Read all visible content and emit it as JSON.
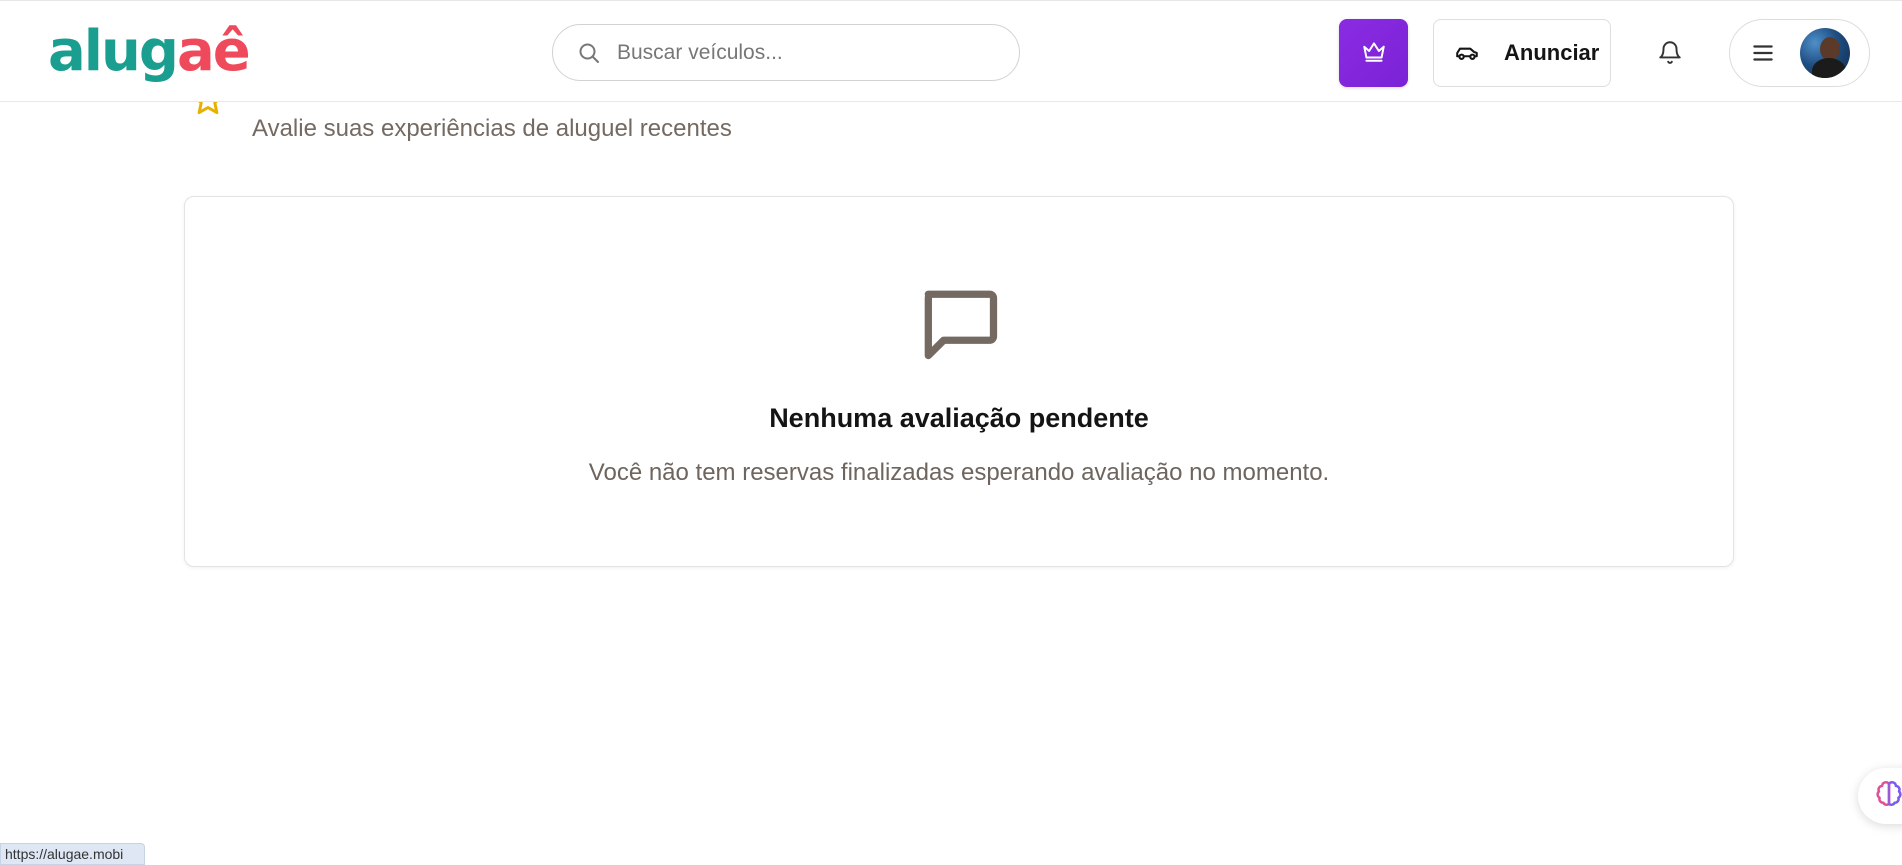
{
  "header": {
    "logo": {
      "part1": "alug",
      "part2": "a",
      "part3": "ê"
    },
    "search": {
      "placeholder": "Buscar veículos..."
    },
    "announce_label": "Anunciar"
  },
  "page": {
    "subtitle": "Avalie suas experiências de aluguel recentes"
  },
  "empty_state": {
    "title": "Nenhuma avaliação pendente",
    "text": "Você não tem reservas finalizadas esperando avaliação no momento."
  },
  "status_bar": {
    "url": "https://alugae.mobi"
  },
  "colors": {
    "brand_teal": "#1a9e8f",
    "brand_coral": "#ef4a5c",
    "premium_purple": "#8a2be2",
    "star_yellow": "#e8b100"
  },
  "icons": {
    "search": "search-icon",
    "premium": "crown-icon",
    "announce": "car-icon",
    "notifications": "bell-icon",
    "menu": "hamburger-icon",
    "empty": "message-square-icon",
    "header": "star-icon",
    "assistant": "brain-icon"
  }
}
